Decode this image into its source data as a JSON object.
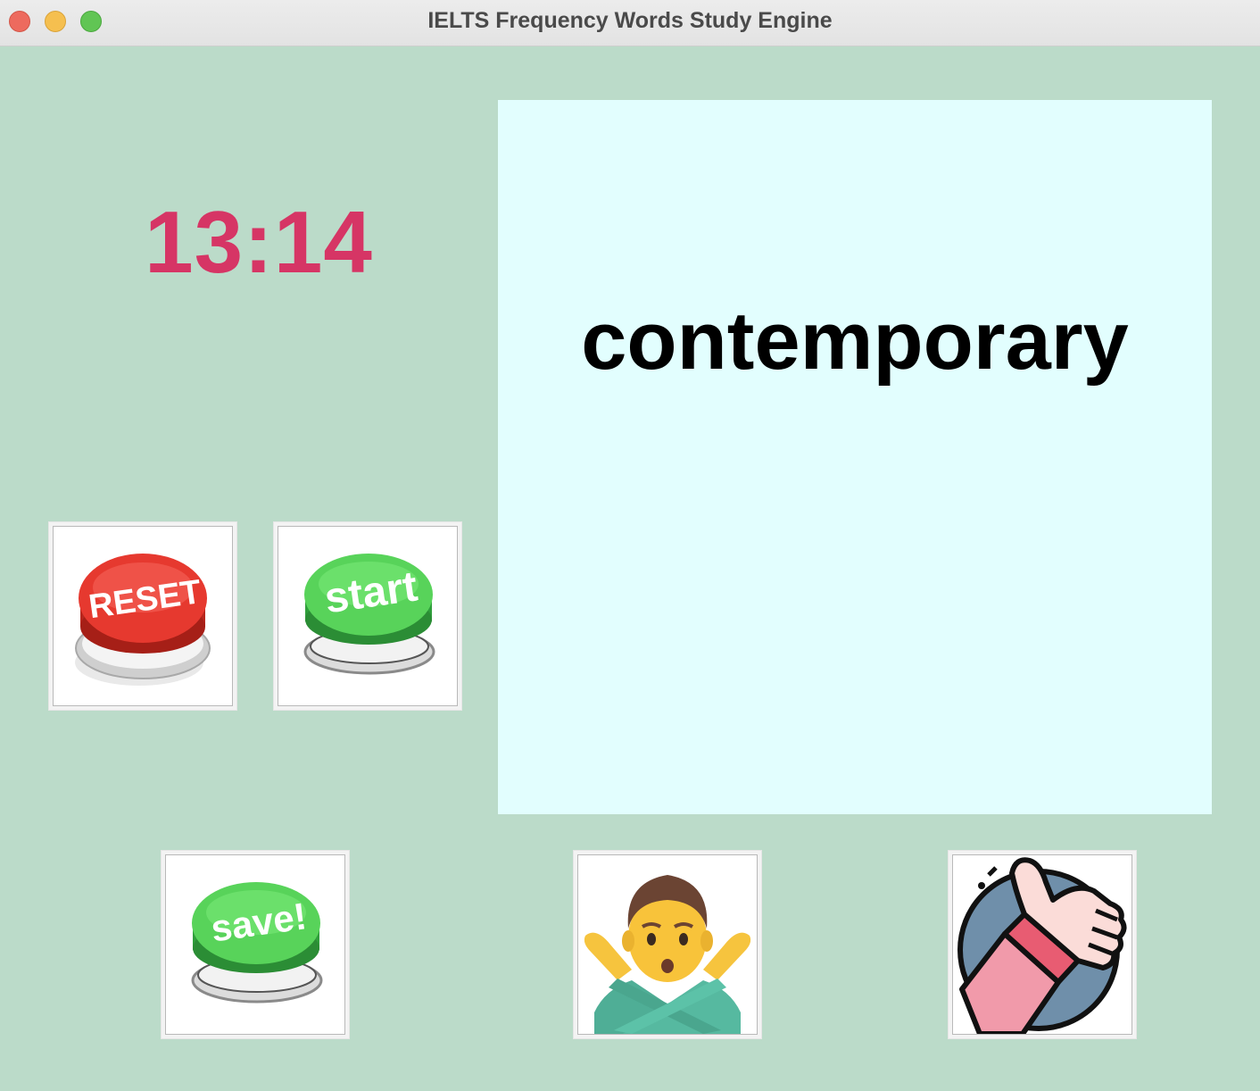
{
  "window": {
    "title": "IELTS Frequency Words Study Engine"
  },
  "timer": {
    "value": "13:14"
  },
  "word_card": {
    "word": "contemporary"
  },
  "buttons": {
    "reset_label": "RESET",
    "start_label": "start",
    "save_label": "save!"
  },
  "icons": {
    "reset": "red-reset-button-icon",
    "start": "green-start-button-icon",
    "save": "green-save-button-icon",
    "reject": "man-crossing-arms-icon",
    "approve": "thumbs-up-icon"
  },
  "colors": {
    "background": "#bbdbc9",
    "timer": "#d63565",
    "word_panel": "#e2fefe"
  }
}
